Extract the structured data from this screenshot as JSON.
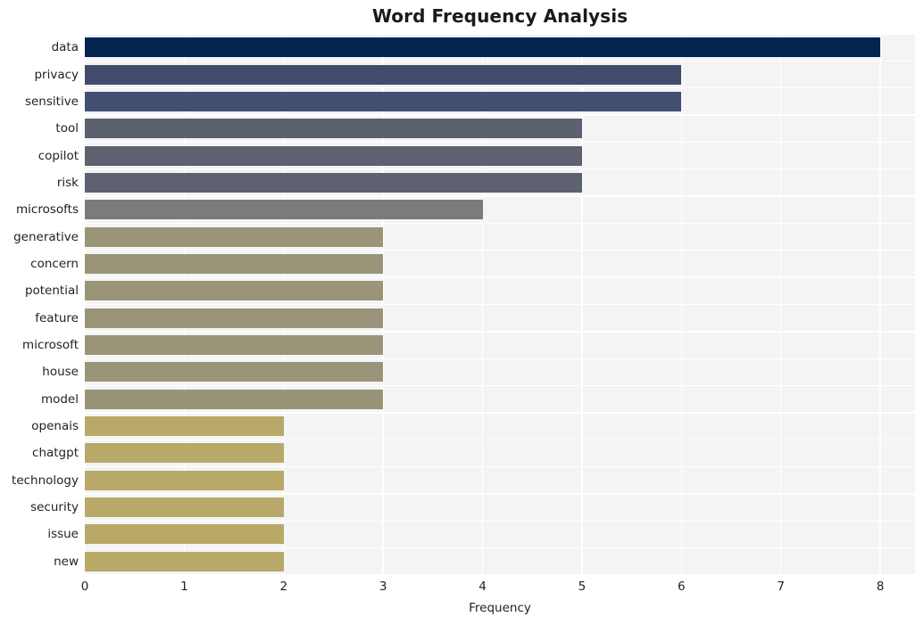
{
  "chart_data": {
    "type": "bar",
    "orientation": "horizontal",
    "title": "Word Frequency Analysis",
    "xlabel": "Frequency",
    "ylabel": "",
    "xlim": [
      0,
      8.35
    ],
    "xticks": [
      0,
      1,
      2,
      3,
      4,
      5,
      6,
      7,
      8
    ],
    "xtick_labels": [
      "0",
      "1",
      "2",
      "3",
      "4",
      "5",
      "6",
      "7",
      "8"
    ],
    "grid": true,
    "legend": false,
    "background": "#f4f4f4",
    "gridline_color": "#ffffff",
    "categories": [
      "data",
      "privacy",
      "sensitive",
      "tool",
      "copilot",
      "risk",
      "microsofts",
      "generative",
      "concern",
      "potential",
      "feature",
      "microsoft",
      "house",
      "model",
      "openais",
      "chatgpt",
      "technology",
      "security",
      "issue",
      "new"
    ],
    "values": [
      8,
      6,
      6,
      5,
      5,
      5,
      4,
      3,
      3,
      3,
      3,
      3,
      3,
      3,
      2,
      2,
      2,
      2,
      2,
      2
    ],
    "bar_colors": [
      "#04254f",
      "#424b6b",
      "#424f70",
      "#5c606f",
      "#5e6170",
      "#5e6170",
      "#7b7b79",
      "#9a9479",
      "#9a9479",
      "#9a9479",
      "#9a9479",
      "#9a9479",
      "#9a9479",
      "#999377",
      "#b8a968",
      "#b8a968",
      "#b8a968",
      "#b8a968",
      "#b8a968",
      "#b8a968"
    ]
  }
}
